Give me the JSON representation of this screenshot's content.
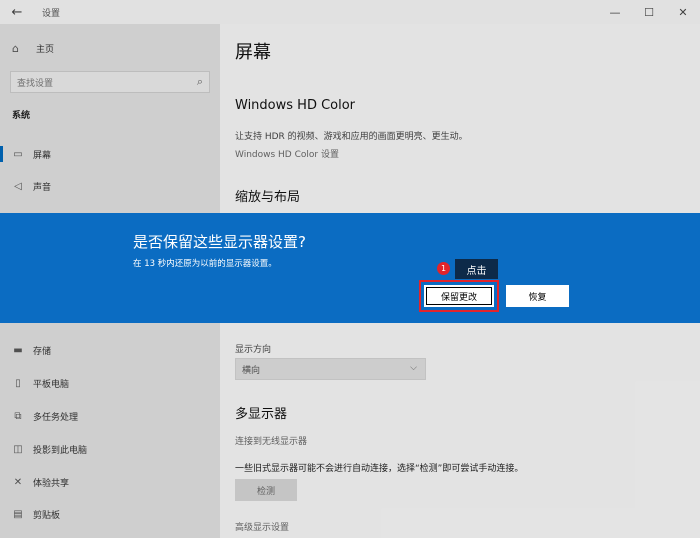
{
  "window": {
    "title": "设置",
    "back_icon": "←",
    "minimize": "—",
    "maximize": "☐",
    "close": "✕"
  },
  "sidebar": {
    "home_label": "主页",
    "search_placeholder": "查找设置",
    "section": "系统",
    "items": [
      {
        "label": "屏幕",
        "icon": "monitor-icon"
      },
      {
        "label": "声音",
        "icon": "speaker-icon"
      },
      {
        "label": "存储",
        "icon": "storage-icon"
      },
      {
        "label": "平板电脑",
        "icon": "tablet-icon"
      },
      {
        "label": "多任务处理",
        "icon": "multitask-icon"
      },
      {
        "label": "投影到此电脑",
        "icon": "project-icon"
      },
      {
        "label": "体验共享",
        "icon": "share-icon"
      },
      {
        "label": "剪贴板",
        "icon": "clipboard-icon"
      }
    ]
  },
  "main": {
    "title": "屏幕",
    "hdr_heading": "Windows HD Color",
    "hdr_desc": "让支持 HDR 的视频、游戏和应用的画面更明亮、更生动。",
    "hdr_link": "Windows HD Color 设置",
    "scale_heading": "缩放与布局",
    "orientation_label": "显示方向",
    "orientation_value": "横向",
    "multi_heading": "多显示器",
    "wireless_link": "连接到无线显示器",
    "detect_desc": "一些旧式显示器可能不会进行自动连接，选择“检测”即可尝试手动连接。",
    "detect_button": "检测",
    "advanced_link": "高级显示设置"
  },
  "dialog": {
    "question": "是否保留这些显示器设置?",
    "countdown": "在 13 秒内还原为以前的显示器设置。",
    "keep_button": "保留更改",
    "restore_button": "恢复"
  },
  "annotation": {
    "step": "1",
    "tip": "点击",
    "highlight_color": "#e1242b"
  },
  "colors": {
    "accent": "#0b6cc2",
    "tooltip": "#0d2a49"
  }
}
